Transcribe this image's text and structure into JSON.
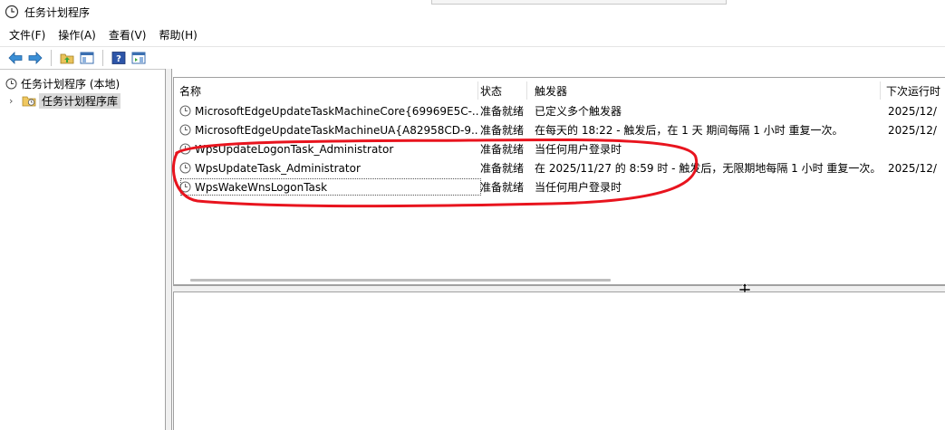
{
  "window": {
    "title": "任务计划程序",
    "icon": "clock-icon"
  },
  "menu": [
    {
      "label": "文件(F)"
    },
    {
      "label": "操作(A)"
    },
    {
      "label": "查看(V)"
    },
    {
      "label": "帮助(H)"
    }
  ],
  "toolbar": {
    "buttons": [
      "back-arrow-icon",
      "forward-arrow-icon",
      "up-folder-icon",
      "show-hide-console-tree-icon",
      "help-icon",
      "show-hide-action-pane-icon"
    ]
  },
  "tree": {
    "root": "任务计划程序 (本地)",
    "child": "任务计划程序库"
  },
  "tasklist": {
    "columns": [
      "名称",
      "状态",
      "触发器",
      "下次运行时"
    ],
    "rows": [
      {
        "name": "MicrosoftEdgeUpdateTaskMachineCore{69969E5C-...",
        "status": "准备就绪",
        "trigger": "已定义多个触发器",
        "next_run": "2025/12/"
      },
      {
        "name": "MicrosoftEdgeUpdateTaskMachineUA{A82958CD-9...",
        "status": "准备就绪",
        "trigger": "在每天的 18:22 - 触发后，在 1 天 期间每隔 1 小时 重复一次。",
        "next_run": "2025/12/"
      },
      {
        "name": "WpsUpdateLogonTask_Administrator",
        "status": "准备就绪",
        "trigger": "当任何用户登录时",
        "next_run": ""
      },
      {
        "name": "WpsUpdateTask_Administrator",
        "status": "准备就绪",
        "trigger": "在 2025/11/27 的 8:59 时 - 触发后，无限期地每隔 1 小时 重复一次。",
        "next_run": "2025/12/"
      },
      {
        "name": "WpsWakeWnsLogonTask",
        "status": "准备就绪",
        "trigger": "当任何用户登录时",
        "next_run": ""
      }
    ]
  },
  "annotation_color": "#e8141e"
}
